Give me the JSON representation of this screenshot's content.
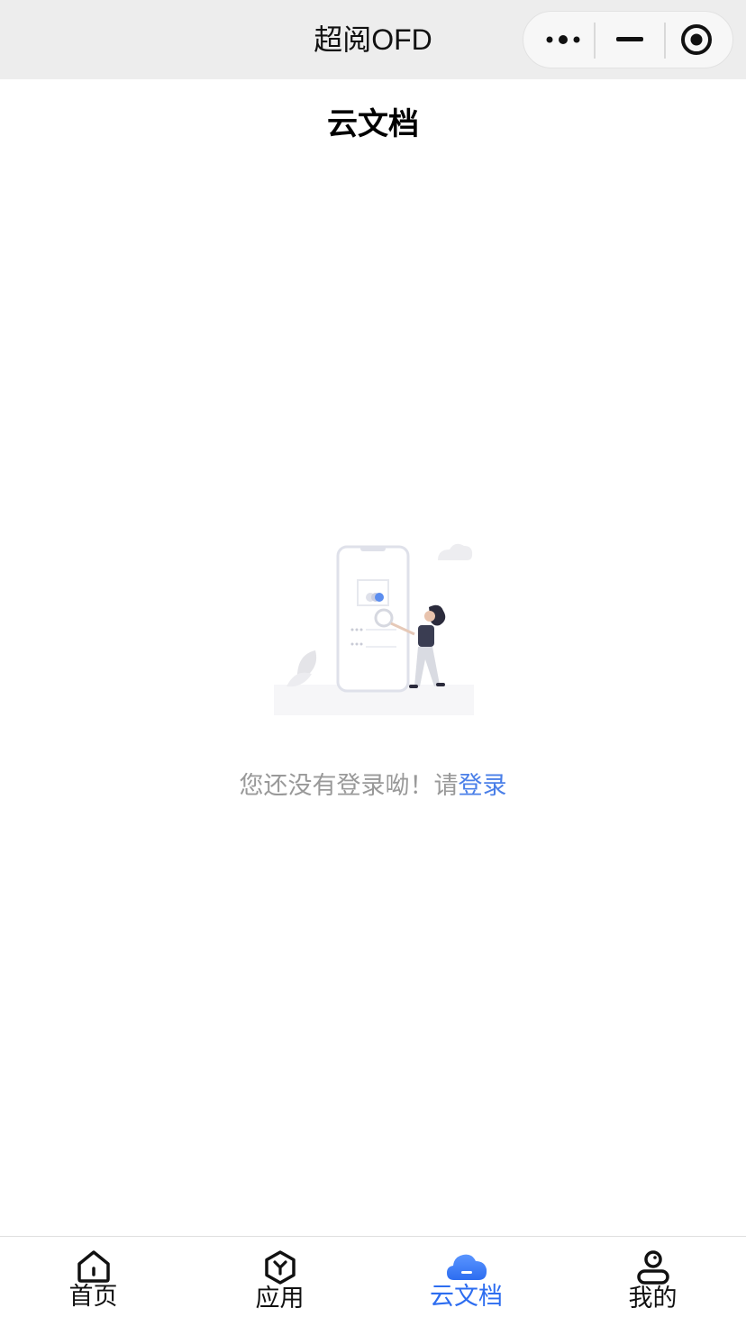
{
  "window": {
    "title": "超阅OFD"
  },
  "capsule": {
    "more_icon": "more-dots-icon",
    "minimize_icon": "minimize-icon",
    "close_icon": "target-close-icon"
  },
  "page": {
    "title": "云文档"
  },
  "empty_state": {
    "message": "您还没有登录呦！请",
    "login_link": "登录",
    "illustration": "phone-search-illustration"
  },
  "tabbar": {
    "active_color": "#2d6df0",
    "items": [
      {
        "label": "首页",
        "icon": "home-icon",
        "active": false
      },
      {
        "label": "应用",
        "icon": "apps-hexagon-icon",
        "active": false
      },
      {
        "label": "云文档",
        "icon": "cloud-icon",
        "active": true
      },
      {
        "label": "我的",
        "icon": "profile-icon",
        "active": false
      }
    ]
  }
}
